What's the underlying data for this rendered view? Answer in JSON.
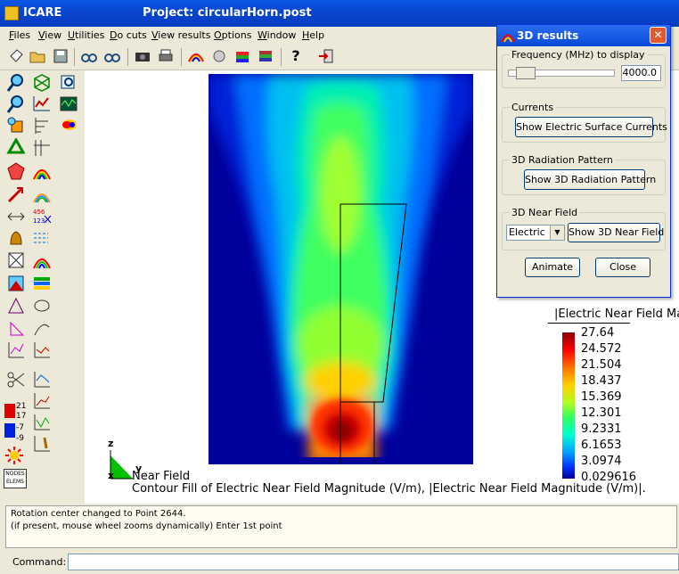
{
  "app": {
    "name": "ICARE",
    "window_title": "Project: circularHorn.post"
  },
  "menu": [
    "Files",
    "View",
    "Utilities",
    "Do cuts",
    "View results",
    "Options",
    "Window",
    "Help"
  ],
  "plot": {
    "legend_title": "|Electric Near Field Ma",
    "legend_values": [
      "27.64",
      "24.572",
      "21.504",
      "18.437",
      "15.369",
      "12.301",
      "9.2331",
      "6.1653",
      "3.0974",
      "0.029616"
    ],
    "caption_line1": "Near Field",
    "caption_line2": "Contour Fill of Electric Near Field Magnitude (V/m), |Electric Near Field Magnitude (V/m)|.",
    "axes": {
      "z": "z",
      "x": "x",
      "y": "y"
    }
  },
  "left_toolbar_labels": {
    "top": "21",
    "t17": "17",
    "tm7": "-7",
    "tm9": "-9",
    "nodes": "NODES",
    "elems": "ELEMS",
    "l456": "456",
    "l123": "123"
  },
  "dialog": {
    "title": "3D results",
    "close_glyph": "✕",
    "frequency": {
      "label": "Frequency (MHz) to display",
      "value": "4000.0"
    },
    "currents": {
      "group_label": "Currents",
      "button": "Show Electric Surface Currents"
    },
    "radiation": {
      "group_label": "3D Radiation Pattern",
      "button": "Show 3D Radiation Pattern"
    },
    "near_field": {
      "group_label": "3D Near Field",
      "select_value": "Electric",
      "button": "Show 3D Near Field"
    },
    "animate_button": "Animate",
    "close_button": "Close"
  },
  "status": {
    "line1": "Rotation center changed to Point 2644.",
    "line2": "(if present, mouse wheel zooms dynamically) Enter 1st point"
  },
  "command": {
    "label": "Command:",
    "value": ""
  },
  "colors": {
    "titlebar": "#0846d0",
    "panel": "#ece9d8",
    "field_background": "#00009a",
    "field_peak": "#ff0000"
  }
}
